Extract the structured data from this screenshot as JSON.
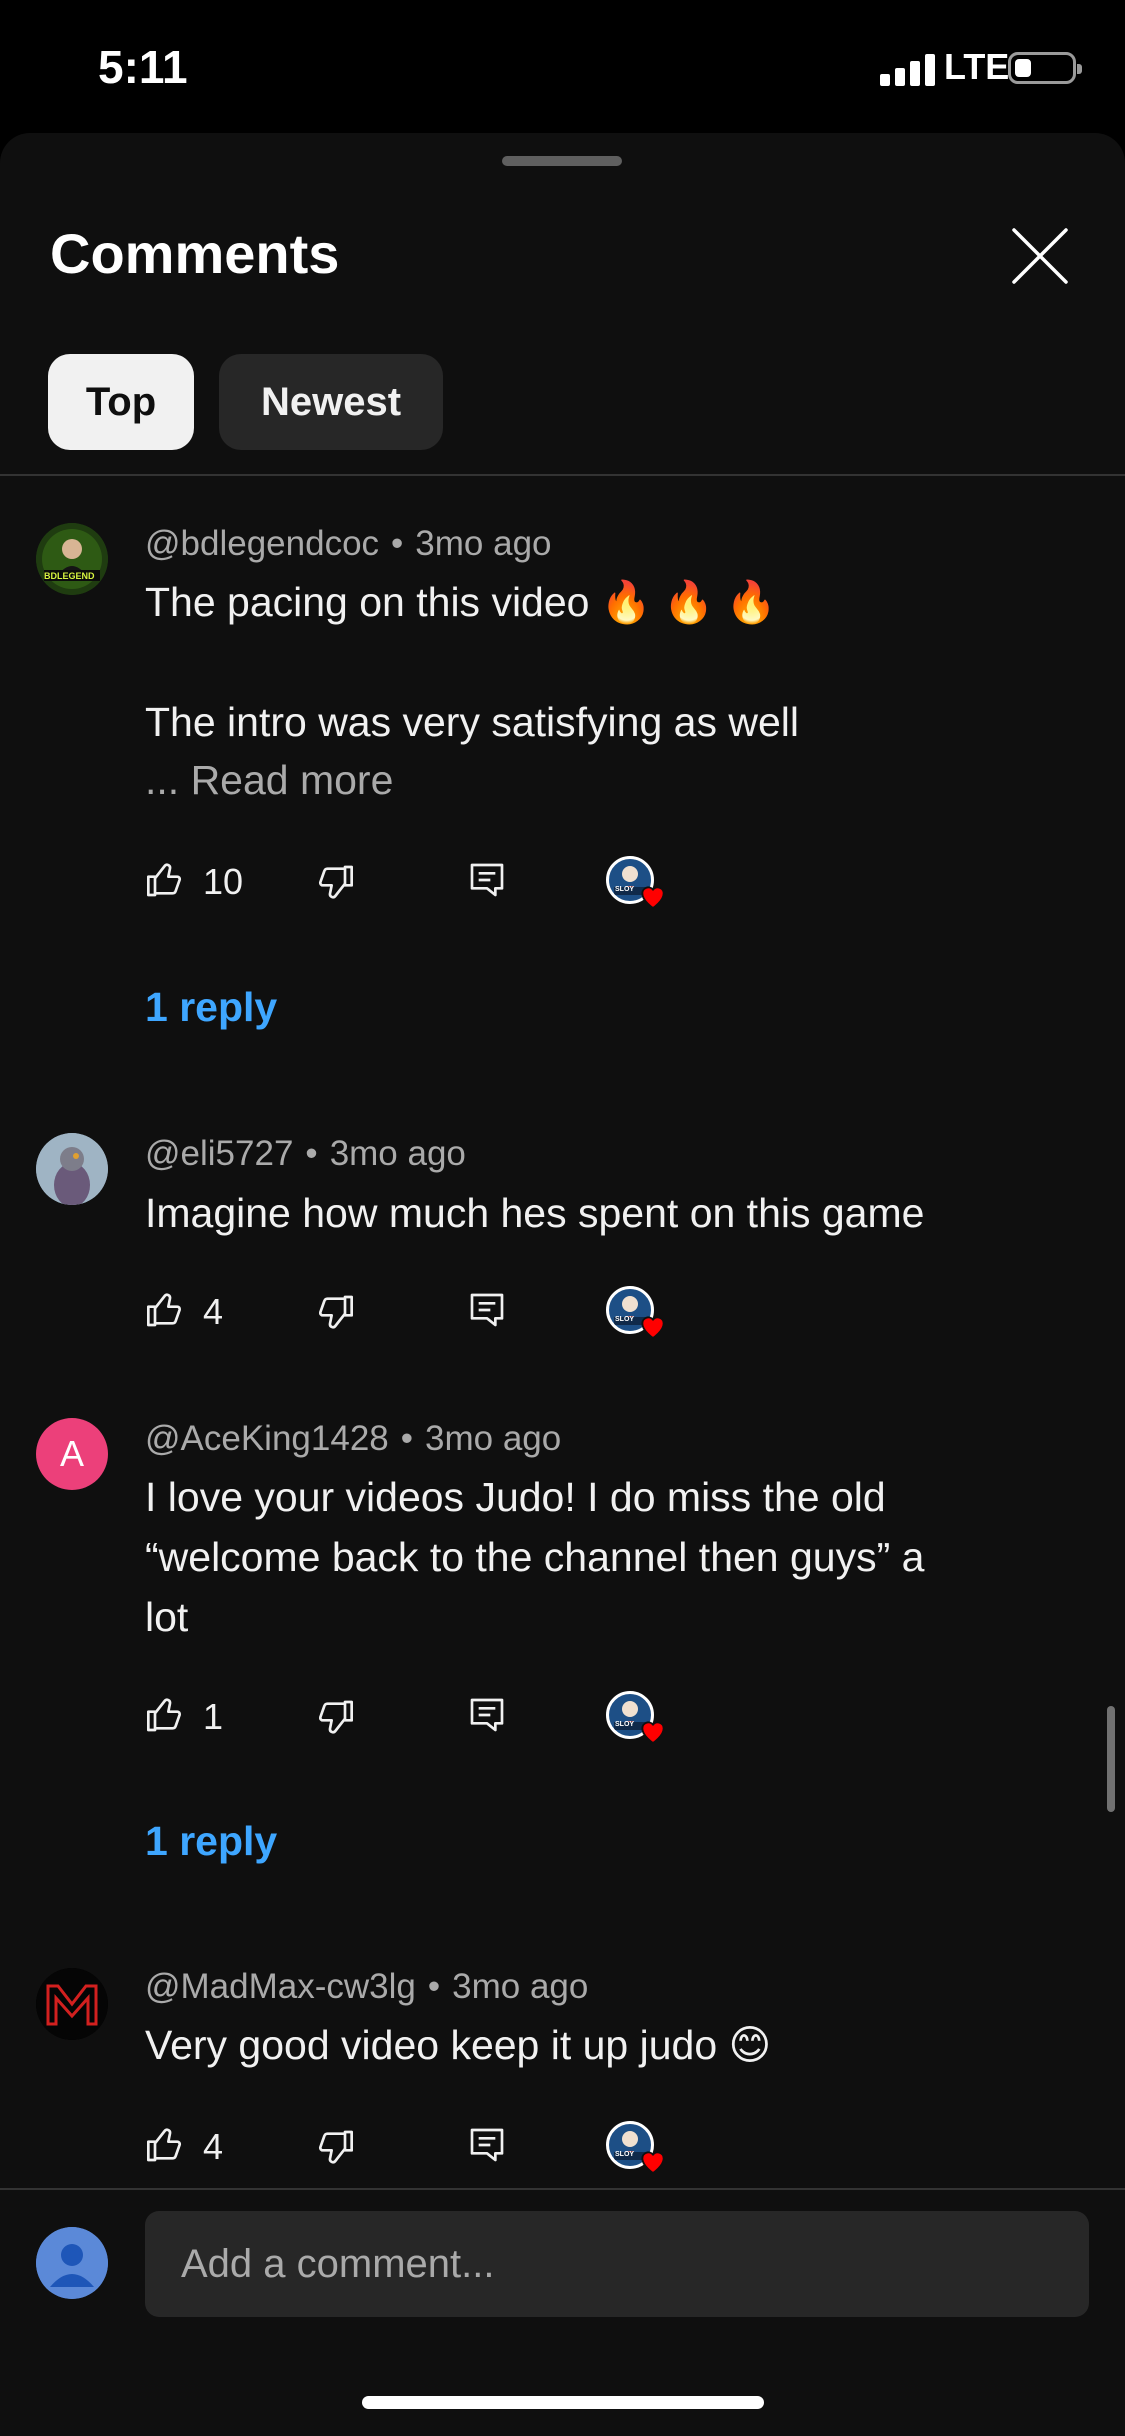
{
  "status_bar": {
    "time": "5:11",
    "network": "LTE",
    "battery_level": 0.28
  },
  "sheet": {
    "title": "Comments",
    "close_icon": "close-icon",
    "tabs": [
      {
        "label": "Top",
        "selected": true
      },
      {
        "label": "Newest",
        "selected": false
      }
    ]
  },
  "comments": [
    {
      "author": "@bdlegendcoc",
      "time": "3mo ago",
      "text_lines": [
        "The pacing on this video 🔥 🔥 🔥",
        "",
        "The intro was very satisfying as well"
      ],
      "read_more": "... Read more",
      "likes": "10",
      "avatar_text": "BDLEGEND",
      "replies": "1 reply"
    },
    {
      "author": "@eli5727",
      "time": "3mo ago",
      "text_lines": [
        "Imagine how much hes spent on this game"
      ],
      "likes": "4"
    },
    {
      "author": "@AceKing1428",
      "time": "3mo ago",
      "text_lines": [
        "I love your videos Judo! I do miss the old",
        "“welcome back to the channel then guys” a",
        "lot"
      ],
      "likes": "1",
      "avatar_text": "A",
      "replies": "1 reply"
    },
    {
      "author": "@MadMax-cw3lg",
      "time": "3mo ago",
      "text_lines": [
        "Very good video keep it up judo 😊"
      ],
      "likes": "4"
    }
  ],
  "creator_badge_text": "SLOY",
  "colors": {
    "accent_link": "#3ea6ff",
    "background": "#0f0f0f",
    "chip_selected": "#f1f1f1",
    "heart": "#ff0000",
    "avatar_ace": "#ec407a"
  },
  "composer": {
    "placeholder": "Add a comment..."
  }
}
